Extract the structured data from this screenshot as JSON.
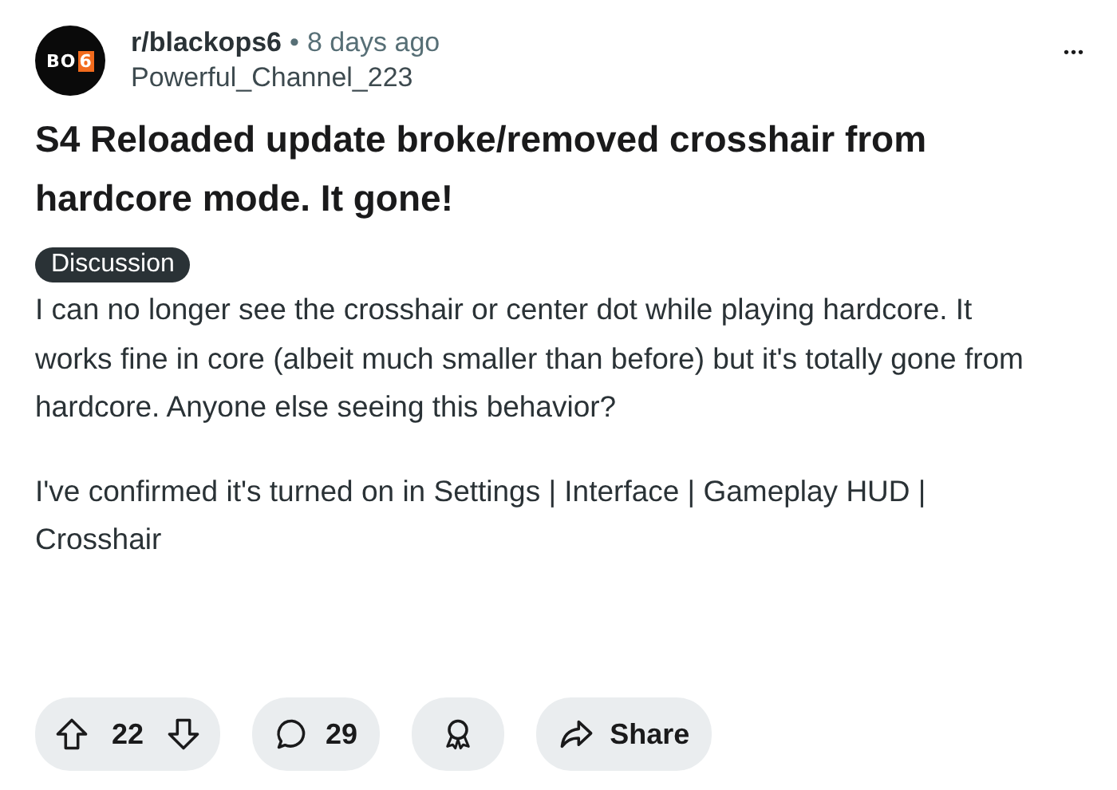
{
  "post": {
    "avatar_logo": {
      "main": "BO",
      "accent": "6"
    },
    "subreddit": "r/blackops6",
    "separator": "•",
    "time": "8 days ago",
    "author": "Powerful_Channel_223",
    "more": "•••",
    "title": "S4 Reloaded update broke/removed crosshair from hardcore mode. It gone!",
    "flair": "Discussion",
    "paragraphs": [
      "I can no longer see the crosshair or center dot while playing hardcore. It works fine in core (albeit much smaller than before) but it's totally gone from hardcore. Anyone else seeing this behavior?",
      "I've confirmed it's turned on in Settings | Interface | Gameplay HUD | Crosshair"
    ],
    "actions": {
      "votes": "22",
      "comments": "29",
      "share": "Share"
    }
  }
}
